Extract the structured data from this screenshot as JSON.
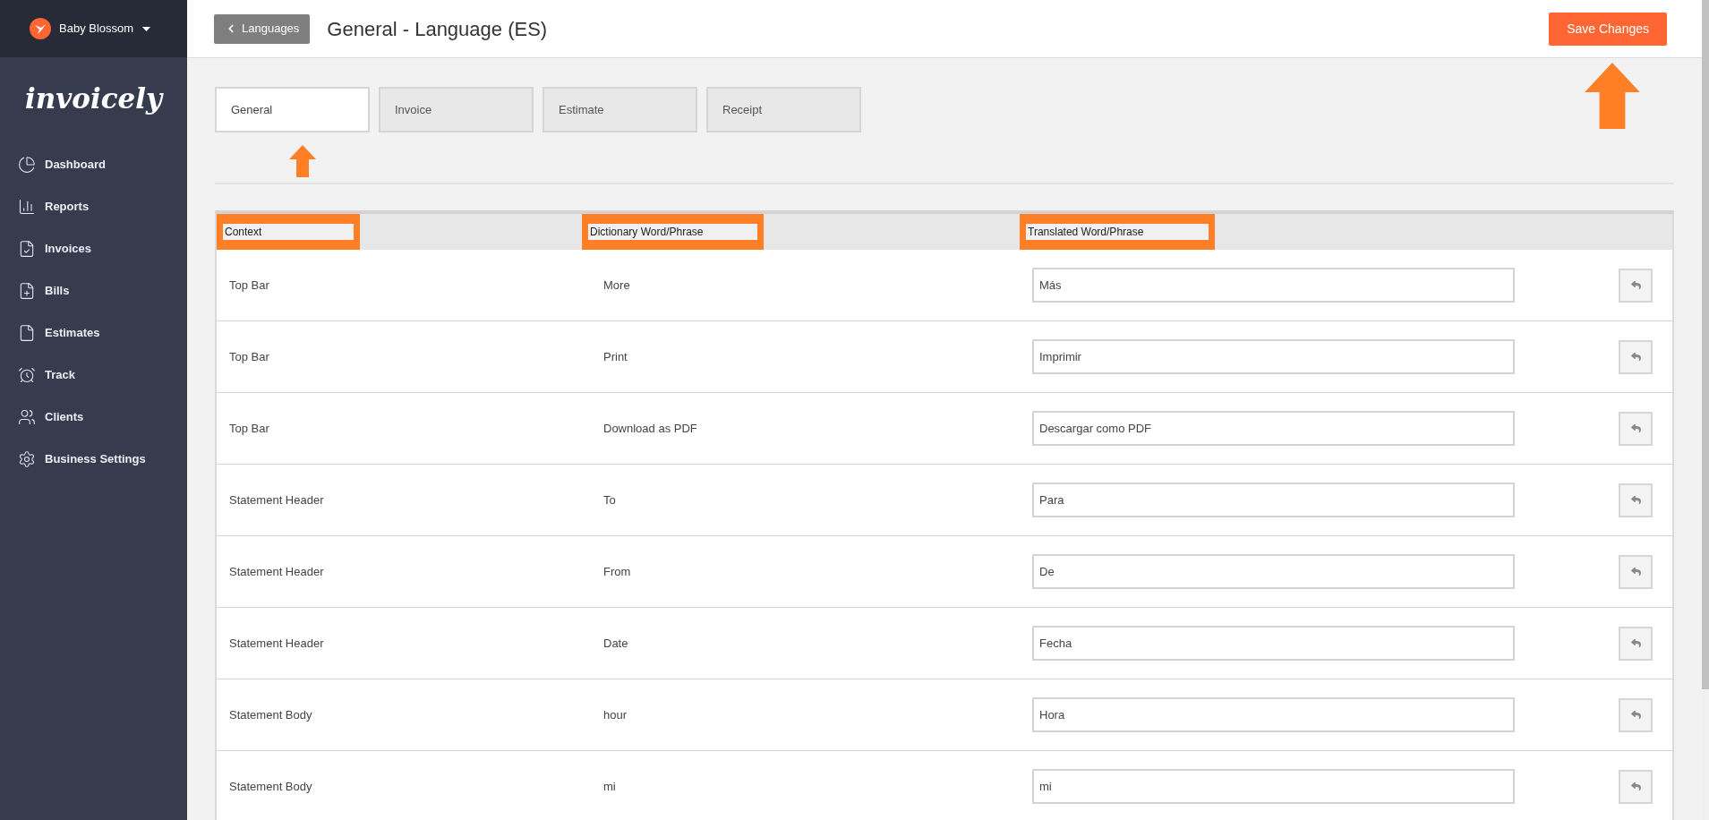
{
  "account": {
    "name": "Baby Blossom"
  },
  "logo": "invoicely",
  "sidebar": {
    "items": [
      {
        "kind": "dashboard",
        "label": "Dashboard"
      },
      {
        "kind": "reports",
        "label": "Reports"
      },
      {
        "kind": "invoices",
        "label": "Invoices"
      },
      {
        "kind": "bills",
        "label": "Bills"
      },
      {
        "kind": "estimates",
        "label": "Estimates"
      },
      {
        "kind": "track",
        "label": "Track"
      },
      {
        "kind": "clients",
        "label": "Clients"
      },
      {
        "kind": "settings",
        "label": "Business Settings"
      }
    ]
  },
  "back_button": "Languages",
  "title": "General - Language (ES)",
  "save_button": "Save Changes",
  "tabs": [
    {
      "label": "General",
      "selected": true
    },
    {
      "label": "Invoice",
      "selected": false
    },
    {
      "label": "Estimate",
      "selected": false
    },
    {
      "label": "Receipt",
      "selected": false
    }
  ],
  "table": {
    "columns": [
      "Context",
      "Dictionary Word/Phrase",
      "Translated Word/Phrase"
    ],
    "rows": [
      {
        "context": "Top Bar",
        "word": "More",
        "translation": "Más"
      },
      {
        "context": "Top Bar",
        "word": "Print",
        "translation": "Imprimir"
      },
      {
        "context": "Top Bar",
        "word": "Download as PDF",
        "translation": "Descargar como PDF"
      },
      {
        "context": "Statement Header",
        "word": "To",
        "translation": "Para"
      },
      {
        "context": "Statement Header",
        "word": "From",
        "translation": "De"
      },
      {
        "context": "Statement Header",
        "word": "Date",
        "translation": "Fecha"
      },
      {
        "context": "Statement Body",
        "word": "hour",
        "translation": "Hora"
      },
      {
        "context": "Statement Body",
        "word": "mi",
        "translation": "mi"
      }
    ]
  }
}
